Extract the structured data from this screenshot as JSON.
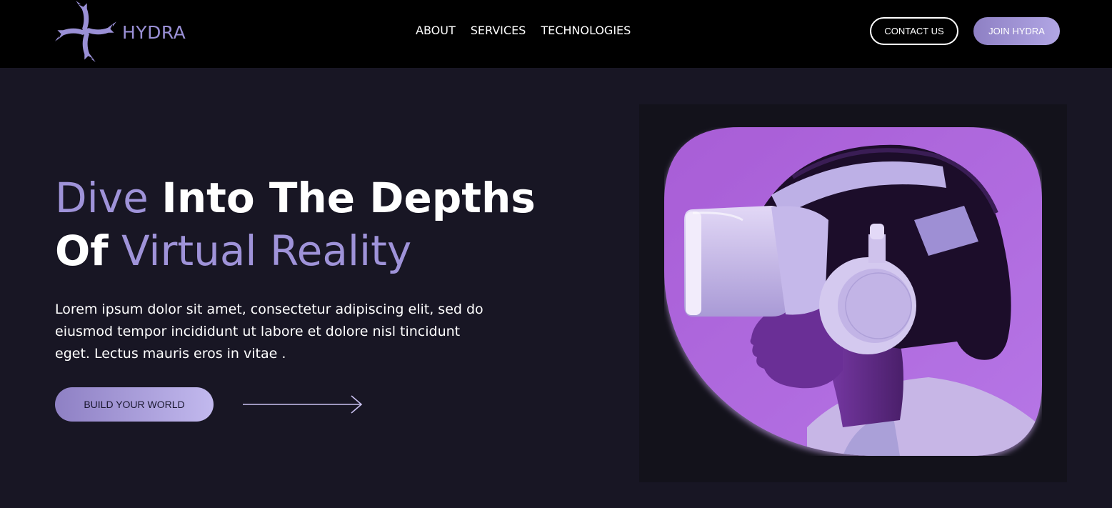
{
  "brand": {
    "name": "HYDRA",
    "logo_icon": "hydra-swirl-logo-icon"
  },
  "nav": {
    "links": [
      "ABOUT",
      "SERVICES",
      "TECHNOLOGIES"
    ],
    "contact_label": "CONTACT US",
    "join_label": "JOIN HYDRA"
  },
  "hero": {
    "headline_line1_accent": "Dive",
    "headline_line1_rest": "Into The Depths",
    "headline_line2_start": "Of",
    "headline_line2_accent": "Virtual Reality",
    "description": "Lorem ipsum dolor sit amet, consectetur adipiscing elit, sed do eiusmod tempor incididunt ut labore et dolore nisl tincidunt eget. Lectus mauris eros in vitae .",
    "cta_label": "BUILD YOUR WORLD",
    "arrow_icon": "arrow-right-icon",
    "image_subject": "vr-headset-person-image"
  },
  "colors": {
    "nav_background": "#000000",
    "page_background": "#181624",
    "accent": "#9f93d9",
    "image_background": "#b46be0"
  }
}
